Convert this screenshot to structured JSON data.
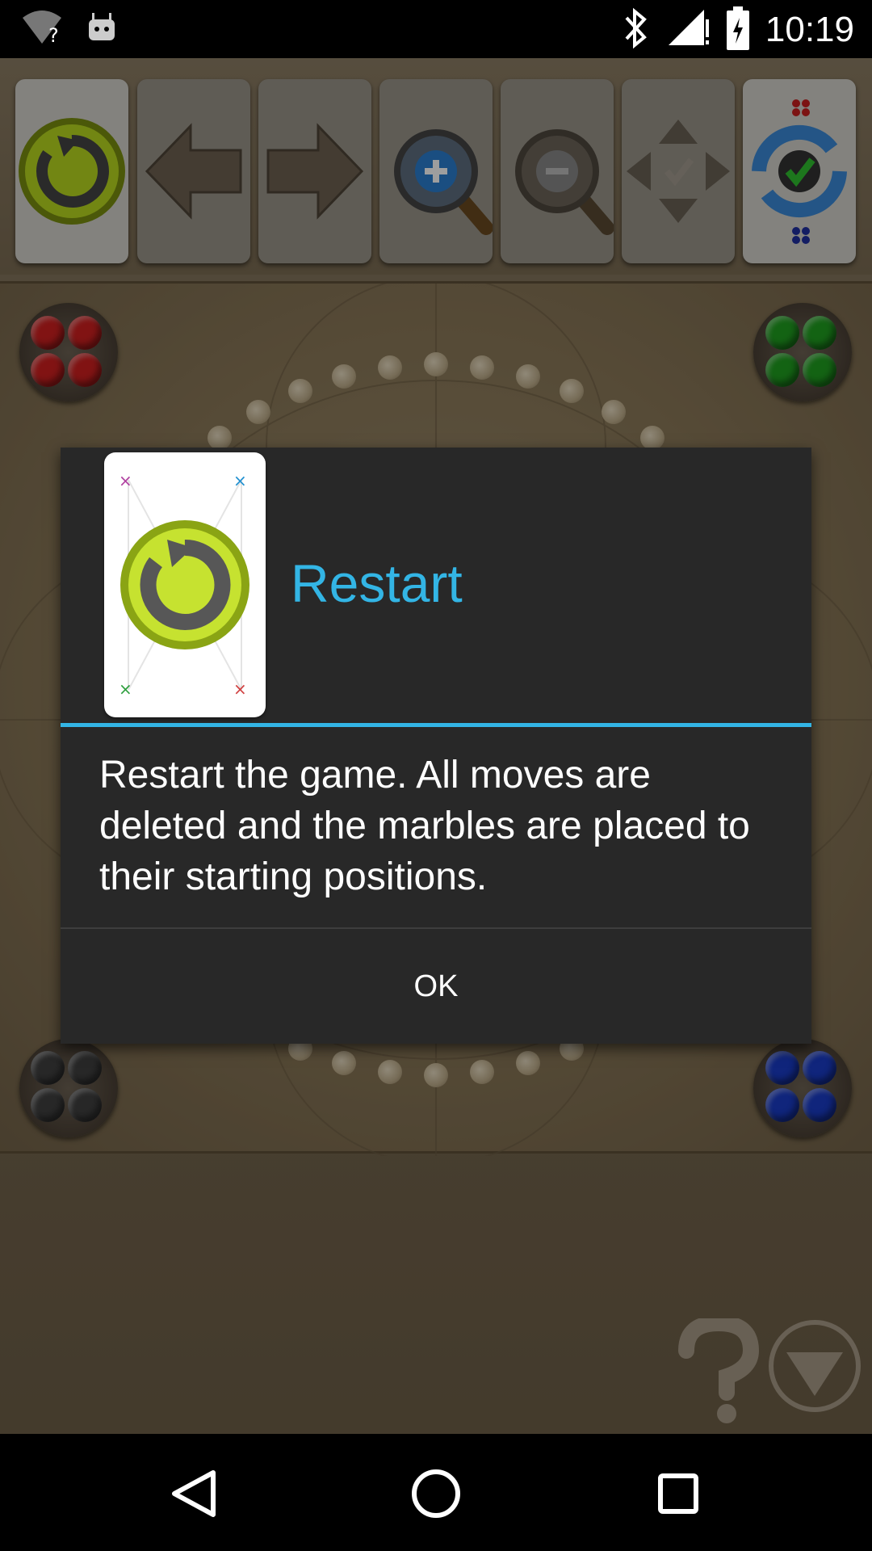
{
  "status_bar": {
    "time": "10:19",
    "icons": [
      "wifi-unknown-icon",
      "android-debug-icon",
      "bluetooth-icon",
      "signal-alert-icon",
      "battery-icon"
    ]
  },
  "toolbar": {
    "buttons": [
      {
        "name": "restart-icon",
        "enabled": true
      },
      {
        "name": "arrow-left-icon",
        "enabled": false
      },
      {
        "name": "arrow-right-icon",
        "enabled": false
      },
      {
        "name": "zoom-in-icon",
        "enabled": true
      },
      {
        "name": "zoom-out-icon",
        "enabled": false
      },
      {
        "name": "fit-screen-icon",
        "enabled": false
      },
      {
        "name": "refresh-check-icon",
        "enabled": true
      }
    ]
  },
  "board": {
    "player_colors": {
      "top_left": "#d02020",
      "top_right": "#20a020",
      "bottom_left": "#404040",
      "bottom_right": "#1a3cc8"
    }
  },
  "dialog": {
    "title": "Restart",
    "message": "Restart the game. All moves are deleted and the marbles are placed to their starting positions.",
    "ok_label": "OK",
    "accent_color": "#33b5e5"
  },
  "nav_bar": {
    "buttons": [
      "back-icon",
      "home-icon",
      "recents-icon"
    ]
  }
}
